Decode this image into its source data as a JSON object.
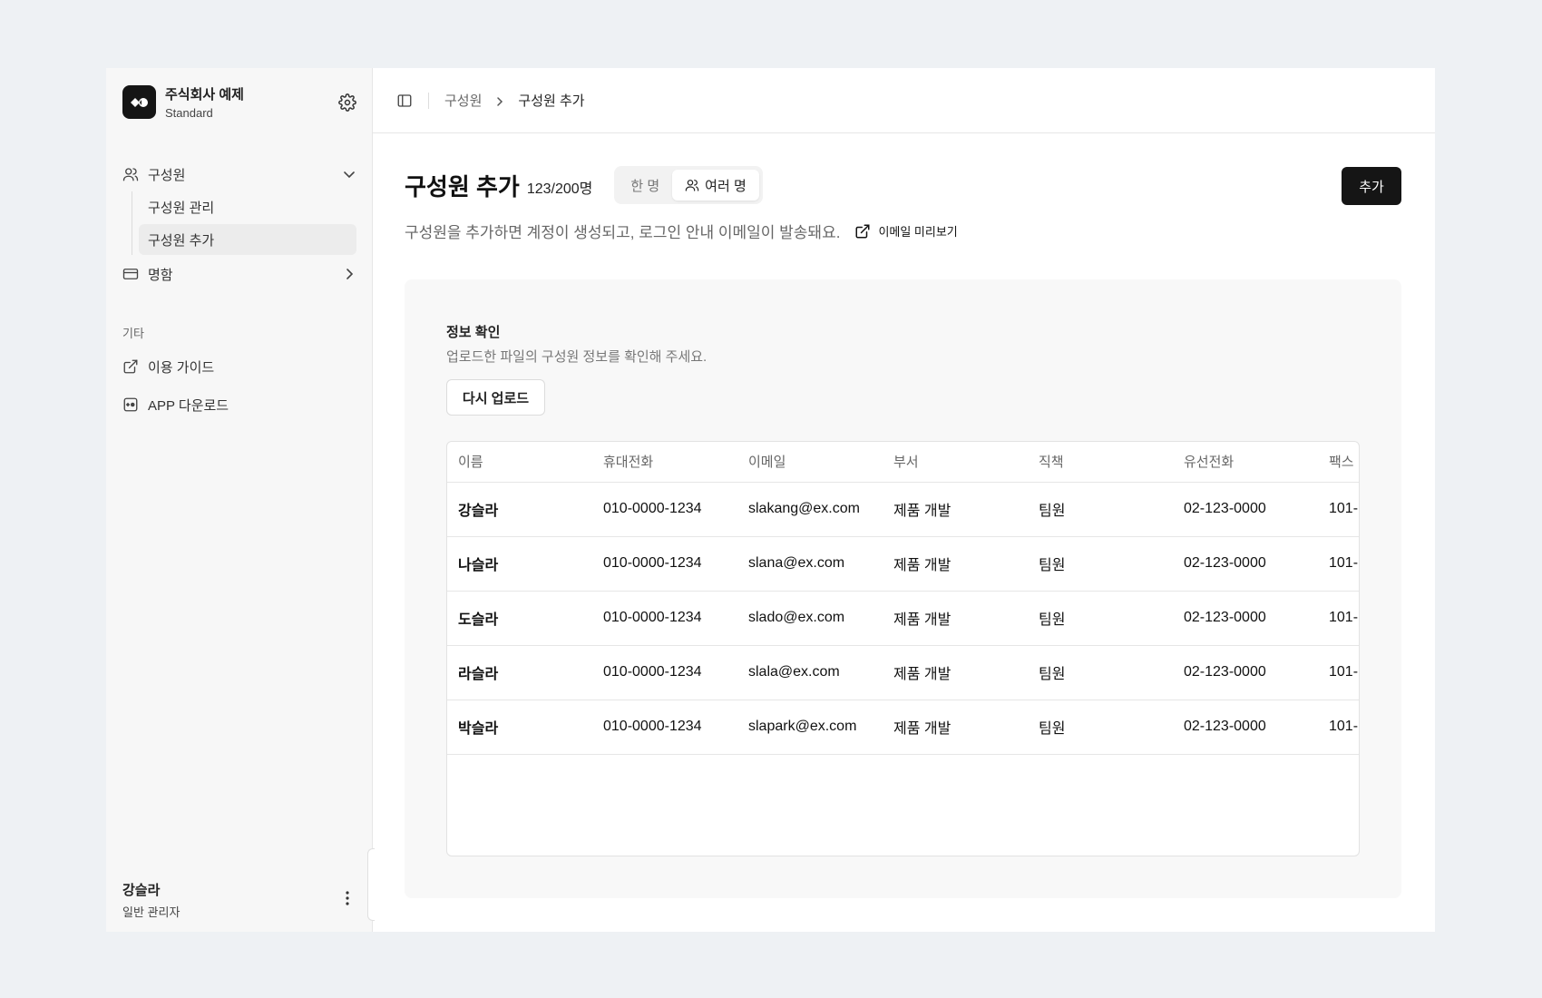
{
  "sidebar": {
    "brand": {
      "name": "주식회사 예제",
      "plan": "Standard"
    },
    "nav": [
      {
        "label": "구성원",
        "expanded": true,
        "children": [
          {
            "label": "구성원 관리"
          },
          {
            "label": "구성원 추가",
            "active": true
          }
        ]
      },
      {
        "label": "명함",
        "expanded": false
      }
    ],
    "section_label": "기타",
    "extra": [
      {
        "label": "이용 가이드"
      },
      {
        "label": "APP 다운로드"
      }
    ],
    "user": {
      "name": "강슬라",
      "role": "일반 관리자"
    }
  },
  "breadcrumb": {
    "parent": "구성원",
    "current": "구성원 추가"
  },
  "header": {
    "title": "구성원 추가",
    "count": "123/200명",
    "segment": {
      "single": "한 명",
      "multiple": "여러 명",
      "selected": "multiple"
    },
    "add_button": "추가",
    "description": "구성원을 추가하면 계정이 생성되고, 로그인 안내 이메일이 발송돼요.",
    "preview_link": "이메일 미리보기"
  },
  "panel": {
    "title": "정보 확인",
    "description": "업로드한 파일의 구성원 정보를 확인해 주세요.",
    "reupload_button": "다시 업로드"
  },
  "table": {
    "columns": [
      "이름",
      "휴대전화",
      "이메일",
      "부서",
      "직책",
      "유선전화",
      "팩스"
    ],
    "rows": [
      [
        "강슬라",
        "010-0000-1234",
        "slakang@ex.com",
        "제품 개발",
        "팀원",
        "02-123-0000",
        "101-"
      ],
      [
        "나슬라",
        "010-0000-1234",
        "slana@ex.com",
        "제품 개발",
        "팀원",
        "02-123-0000",
        "101-"
      ],
      [
        "도슬라",
        "010-0000-1234",
        "slado@ex.com",
        "제품 개발",
        "팀원",
        "02-123-0000",
        "101-"
      ],
      [
        "라슬라",
        "010-0000-1234",
        "slala@ex.com",
        "제품 개발",
        "팀원",
        "02-123-0000",
        "101-"
      ],
      [
        "박슬라",
        "010-0000-1234",
        "slapark@ex.com",
        "제품 개발",
        "팀원",
        "02-123-0000",
        "101-"
      ]
    ]
  },
  "icons": {
    "gear": "gear-icon",
    "users": "users-icon",
    "card": "card-icon",
    "external": "external-link-icon",
    "app": "app-icon",
    "kebab": "kebab-icon",
    "panel": "sidebar-toggle-icon",
    "chevron_right": "chevron-right-icon",
    "chevron_down": "chevron-down-icon"
  },
  "colors": {
    "background": "#eef1f4",
    "primary_button": "#151515",
    "sidebar": "#f7f7f7"
  }
}
